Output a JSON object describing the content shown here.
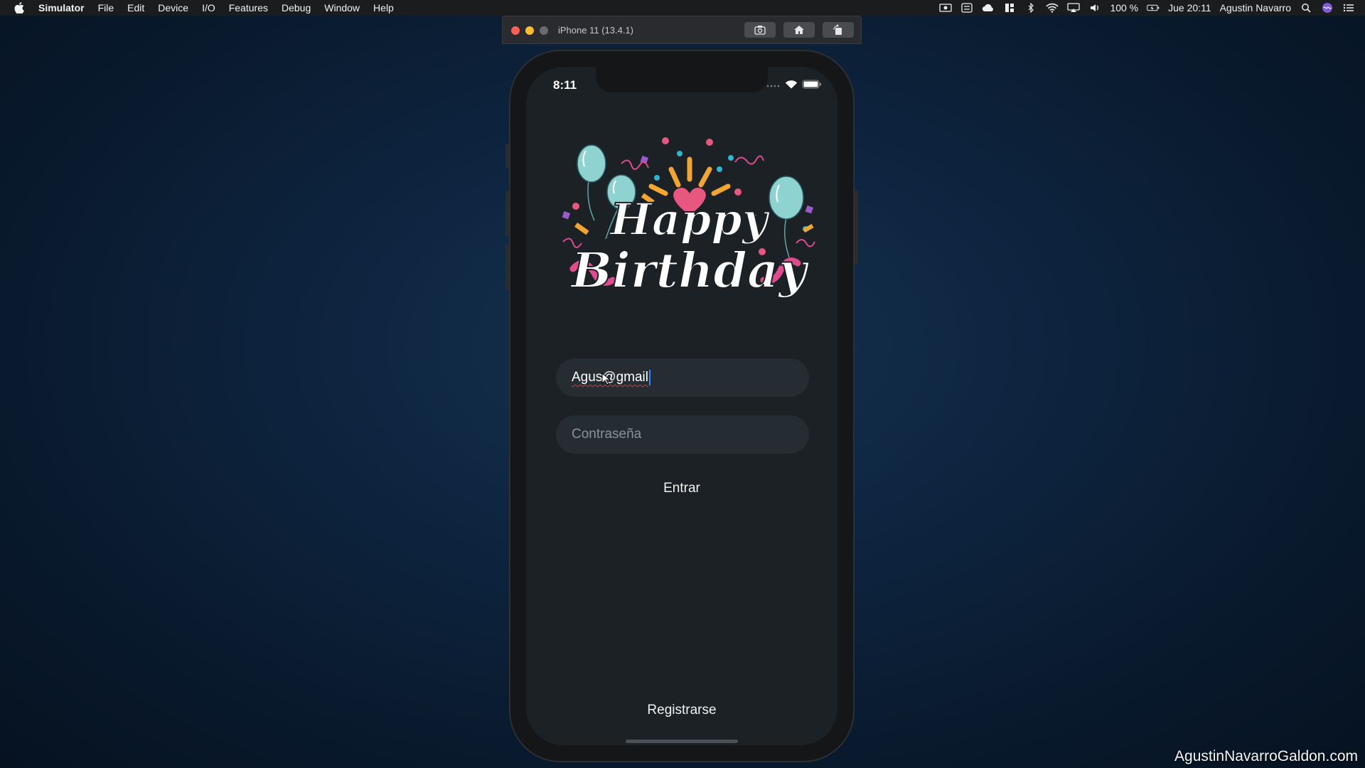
{
  "menubar": {
    "apple_icon": "apple-logo-icon",
    "app_name": "Simulator",
    "items": [
      "File",
      "Edit",
      "Device",
      "I/O",
      "Features",
      "Debug",
      "Window",
      "Help"
    ],
    "battery": "100 %",
    "clock": "Jue 20:11",
    "user": "Agustin Navarro"
  },
  "simulator": {
    "title": "iPhone 11 (13.4.1)",
    "toolbar_icons": [
      "camera-icon",
      "home-icon",
      "rotate-icon"
    ]
  },
  "phone": {
    "status_time": "8:11",
    "email_value": "Agus@gmail",
    "password_placeholder": "Contraseña",
    "login_label": "Entrar",
    "register_label": "Registrarse",
    "logo_line1": "Happy",
    "logo_line2": "Birthday"
  },
  "watermark": "AgustinNavarroGaldon.com",
  "colors": {
    "balloon": "#8fd3d0",
    "ribbon": "#e04a8f",
    "heart": "#e8577f",
    "confetti_orange": "#f2a531",
    "caret": "#3a84ff"
  }
}
